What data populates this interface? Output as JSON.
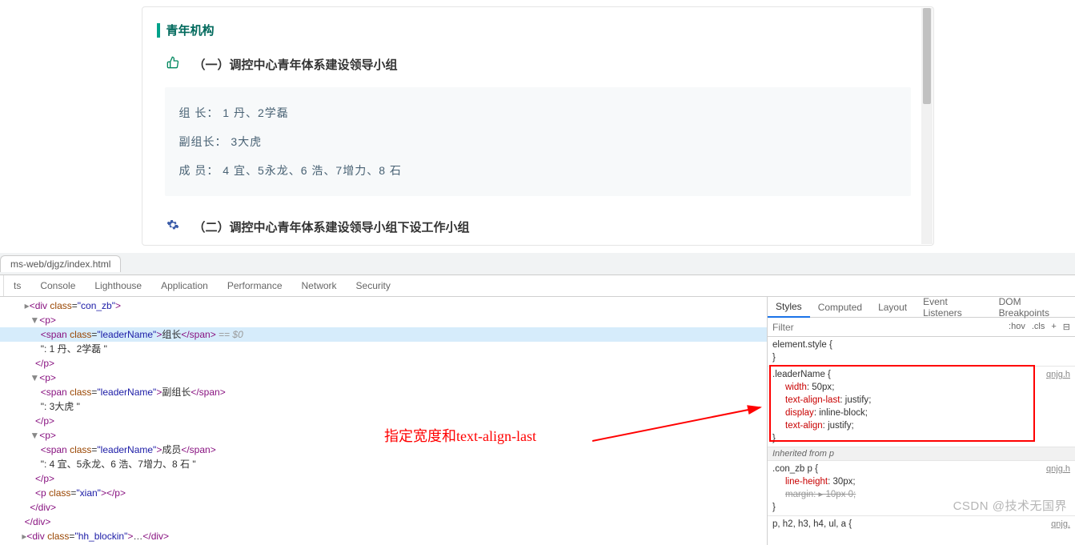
{
  "page": {
    "title": "青年机构",
    "section1": {
      "heading": "（一）调控中心青年体系建设领导小组",
      "leader_label": "组   长：",
      "leader_value": "1 丹、2学磊",
      "vice_label": "副组长：",
      "vice_value": "3大虎",
      "member_label": "成   员：",
      "member_value": " 4 宜、5永龙、6 浩、7增力、8 石"
    },
    "section2": {
      "heading": "（二）调控中心青年体系建设领导小组下设工作小组"
    }
  },
  "browser_tab": "ms-web/djgz/index.html",
  "devtools": {
    "tabs": [
      "ts",
      "Console",
      "Lighthouse",
      "Application",
      "Performance",
      "Network",
      "Security"
    ],
    "dom": {
      "l0": "<div class=\"con_zb\">",
      "l1_open": "<p>",
      "l2_span_open": "<span class=\"leaderName\">",
      "l2_text": "组长",
      "l2_span_close": "</span>",
      "l2_eq": " == $0",
      "l3_text": "\": 1 丹、2学磊 \"",
      "l4_close": "</p>",
      "l5_open": "<p>",
      "l6_span": "<span class=\"leaderName\">副组长</span>",
      "l6_text_inner": "副组长",
      "l7_text": "\": 3大虎 \"",
      "l9_open": "<p>",
      "l10_text_inner": "成员",
      "l11_text": "\": 4 宜、5永龙、6 浩、7增力、8 石 \"",
      "l13_xian": "<p class=\"xian\"></p>",
      "l14_close": "</div>",
      "l15": "<div class=\"hh_blockin\">…</div>"
    },
    "annotation": "指定宽度和text-align-last"
  },
  "styles": {
    "tabs": [
      "Styles",
      "Computed",
      "Layout",
      "Event Listeners",
      "DOM Breakpoints"
    ],
    "filter_placeholder": "Filter",
    "filter_btns": [
      ":hov",
      ".cls",
      "+"
    ],
    "element_style": "element.style {",
    "rule1": {
      "selector": ".leaderName {",
      "src": "qnjg.h",
      "props": [
        [
          "width",
          "50px"
        ],
        [
          "text-align-last",
          "justify"
        ],
        [
          "display",
          "inline-block"
        ],
        [
          "text-align",
          "justify"
        ]
      ]
    },
    "inherit_label": "Inherited from p",
    "rule2": {
      "selector": ".con_zb p {",
      "src": "qnjg.h",
      "props": [
        [
          "line-height",
          "30px"
        ]
      ],
      "strike": "margin: ▸ 10px 0;"
    },
    "rule3": {
      "selector": "p, h2, h3, h4, ul, a {",
      "src": "qnjg."
    }
  },
  "watermark": "CSDN @技术无国界"
}
